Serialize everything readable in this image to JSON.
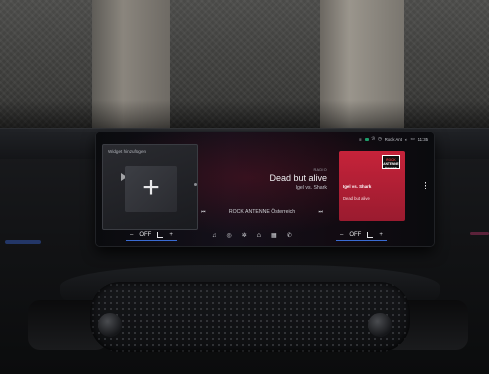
{
  "widget": {
    "title": "Widget hinzufügen",
    "add_symbol": "+"
  },
  "status_bar": {
    "station": "Rock Ant",
    "time": "11:35"
  },
  "now_playing": {
    "label": "RADIO",
    "title": "Dead but alive",
    "artist": "Igel vs. Shark",
    "station_name": "ROCK ANTENNE Österreich",
    "prev_icon": "skip-back-icon",
    "next_icon": "skip-forward-icon"
  },
  "album_card": {
    "logo_line1": "ROCK",
    "logo_line2": "ANTENNE",
    "logo_line3": "Österreich",
    "artist": "Igel vs. Shark",
    "title": "Dead but alive",
    "accent": "#c6233a"
  },
  "climate_left": {
    "minus": "–",
    "temp": "OFF",
    "plus": "+"
  },
  "climate_right": {
    "minus": "–",
    "temp": "OFF",
    "plus": "+"
  },
  "nav_icons": [
    "music-icon",
    "apps-icon",
    "fan-icon",
    "home-icon",
    "grid-icon",
    "phone-icon"
  ]
}
